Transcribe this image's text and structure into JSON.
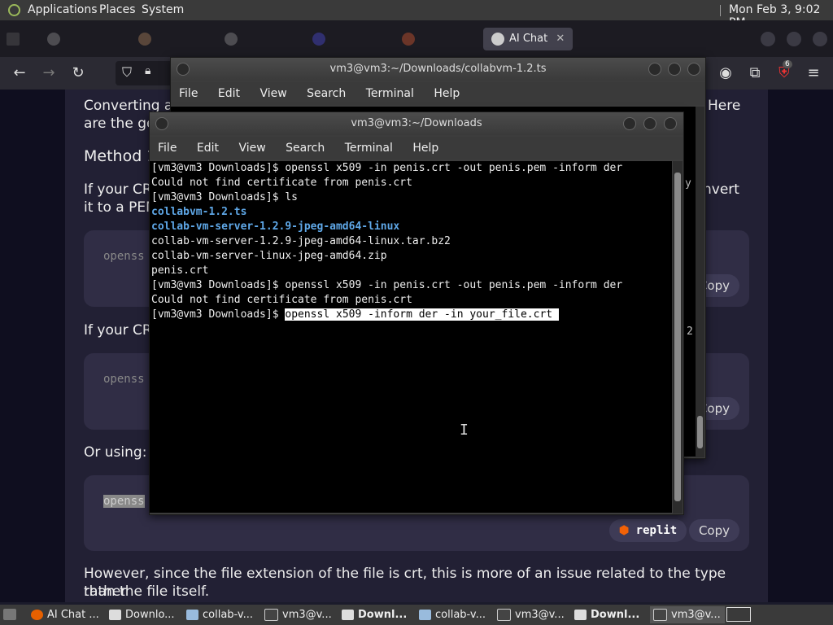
{
  "top_panel": {
    "menus": [
      "Applications",
      "Places",
      "System"
    ],
    "clock": "Mon Feb 3, 9:02 PM"
  },
  "browser": {
    "active_tab": "AI Chat",
    "badge": "6",
    "article": {
      "p1": "Converting a",
      "p1_right": "Here",
      "p2": "are the ge",
      "h_method": "Method 1",
      "p3": "If your CR",
      "p3_right": "nvert",
      "p4": "it to a PEM",
      "p5": "If your CR",
      "p6": "Or using:",
      "code1": "openss",
      "code2": "openss",
      "code3": "openss",
      "copy": "Copy",
      "replit": "replit",
      "p7": "However, since the file extension of the file is crt, this is more of an issue related to the type rather",
      "p8": "than the file itself."
    }
  },
  "term_back": {
    "title": "vm3@vm3:~/Downloads/collabvm-1.2.ts",
    "menu": [
      "File",
      "Edit",
      "View",
      "Search",
      "Terminal",
      "Help"
    ],
    "side_chars": [
      "y",
      "2"
    ]
  },
  "term_front": {
    "title": "vm3@vm3:~/Downloads",
    "menu": [
      "File",
      "Edit",
      "View",
      "Search",
      "Terminal",
      "Help"
    ],
    "lines": [
      {
        "text": "[vm3@vm3 Downloads]$ openssl x509 -in penis.crt -out penis.pem -inform der",
        "style": ""
      },
      {
        "text": "Could not find certificate from penis.crt",
        "style": ""
      },
      {
        "text": "[vm3@vm3 Downloads]$ ls",
        "style": ""
      },
      {
        "text": "collabvm-1.2.ts",
        "style": "dir"
      },
      {
        "text": "collab-vm-server-1.2.9-jpeg-amd64-linux",
        "style": "dir"
      },
      {
        "text": "collab-vm-server-1.2.9-jpeg-amd64-linux.tar.bz2",
        "style": ""
      },
      {
        "text": "collab-vm-server-linux-jpeg-amd64.zip",
        "style": ""
      },
      {
        "text": "penis.crt",
        "style": ""
      },
      {
        "text": "[vm3@vm3 Downloads]$ openssl x509 -in penis.crt -out penis.pem -inform der",
        "style": ""
      },
      {
        "text": "Could not find certificate from penis.crt",
        "style": ""
      }
    ],
    "prompt": "[vm3@vm3 Downloads]$ ",
    "selected": "openssl x509 -inform der -in your_file.crt "
  },
  "taskbar": {
    "items": [
      {
        "label": "AI Chat ...",
        "bold": false
      },
      {
        "label": "Downlo...",
        "bold": false
      },
      {
        "label": "collab-v...",
        "bold": false
      },
      {
        "label": "vm3@v...",
        "bold": false
      },
      {
        "label": "Downl...",
        "bold": true
      },
      {
        "label": "collab-v...",
        "bold": false
      },
      {
        "label": "vm3@v...",
        "bold": false
      },
      {
        "label": "Downl...",
        "bold": true
      },
      {
        "label": "vm3@v...",
        "bold": false
      }
    ]
  },
  "colors": {
    "accent_dir": "#5fa8e8",
    "replit_orange": "#f26207",
    "panel": "#3a3a3a"
  }
}
